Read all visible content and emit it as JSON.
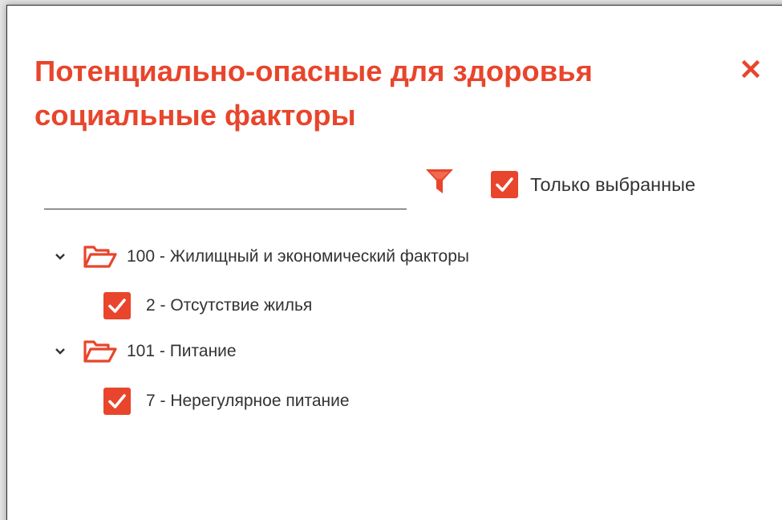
{
  "dialog": {
    "title": "Потенциально-опасные для здоровья социальные факторы",
    "close_icon": "close-icon"
  },
  "search": {
    "value": "",
    "placeholder": ""
  },
  "toolbar": {
    "filter_icon": "filter-icon",
    "only_selected_label": "Только выбранные",
    "only_selected_checked": true
  },
  "tree": {
    "groups": [
      {
        "label": "100 - Жилищный и экономический факторы",
        "expanded": true,
        "items": [
          {
            "label": "2 - Отсутствие жилья",
            "checked": true
          }
        ]
      },
      {
        "label": "101 - Питание",
        "expanded": true,
        "items": [
          {
            "label": "7 - Нерегулярное питание",
            "checked": true
          }
        ]
      }
    ]
  },
  "colors": {
    "accent": "#e8452c",
    "text": "#333333"
  }
}
